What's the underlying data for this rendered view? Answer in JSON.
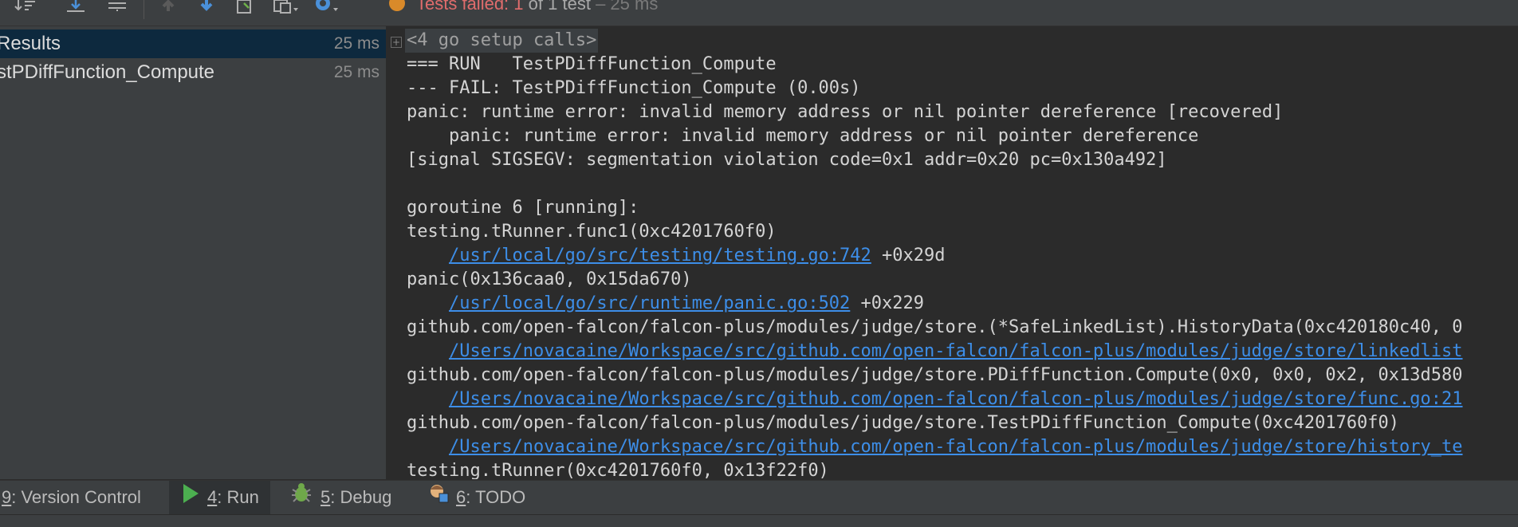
{
  "toolbar": {
    "status": {
      "failed": "Tests failed:",
      "count": "1",
      "of": "of 1 test",
      "time": "– 25 ms"
    }
  },
  "tree": {
    "items": [
      {
        "label": "Results",
        "duration": "25 ms"
      },
      {
        "label": "stPDiffFunction_Compute",
        "duration": "25 ms"
      }
    ]
  },
  "console": {
    "setup": "<4 go setup calls>",
    "lines": [
      {
        "text": "=== RUN   TestPDiffFunction_Compute"
      },
      {
        "text": "--- FAIL: TestPDiffFunction_Compute (0.00s)"
      },
      {
        "text": "panic: runtime error: invalid memory address or nil pointer dereference [recovered]"
      },
      {
        "text": "    panic: runtime error: invalid memory address or nil pointer dereference"
      },
      {
        "text": "[signal SIGSEGV: segmentation violation code=0x1 addr=0x20 pc=0x130a492]"
      },
      {
        "text": ""
      },
      {
        "text": "goroutine 6 [running]:"
      },
      {
        "text": "testing.tRunner.func1(0xc4201760f0)"
      },
      {
        "indent": "    ",
        "link": "/usr/local/go/src/testing/testing.go:742",
        "suffix": " +0x29d"
      },
      {
        "text": "panic(0x136caa0, 0x15da670)"
      },
      {
        "indent": "    ",
        "link": "/usr/local/go/src/runtime/panic.go:502",
        "suffix": " +0x229"
      },
      {
        "text": "github.com/open-falcon/falcon-plus/modules/judge/store.(*SafeLinkedList).HistoryData(0xc420180c40, 0"
      },
      {
        "indent": "    ",
        "link": "/Users/novacaine/Workspace/src/github.com/open-falcon/falcon-plus/modules/judge/store/linkedlist",
        "suffix": ""
      },
      {
        "text": "github.com/open-falcon/falcon-plus/modules/judge/store.PDiffFunction.Compute(0x0, 0x0, 0x2, 0x13d580"
      },
      {
        "indent": "    ",
        "link": "/Users/novacaine/Workspace/src/github.com/open-falcon/falcon-plus/modules/judge/store/func.go:21",
        "suffix": ""
      },
      {
        "text": "github.com/open-falcon/falcon-plus/modules/judge/store.TestPDiffFunction_Compute(0xc4201760f0)"
      },
      {
        "indent": "    ",
        "link": "/Users/novacaine/Workspace/src/github.com/open-falcon/falcon-plus/modules/judge/store/history_te",
        "suffix": ""
      },
      {
        "text": "testing.tRunner(0xc4201760f0, 0x13f22f0)"
      }
    ]
  },
  "bottombar": {
    "tabs": [
      {
        "key": "9",
        "label": ": Version Control",
        "icon": "none"
      },
      {
        "key": "4",
        "label": ": Run",
        "icon": "play-icon"
      },
      {
        "key": "5",
        "label": ": Debug",
        "icon": "bug-icon"
      },
      {
        "key": "6",
        "label": ": TODO",
        "icon": "todo-icon"
      }
    ]
  },
  "colors": {
    "link": "#3d8ee8",
    "failed": "#e06c6c",
    "run": "#4caf50",
    "warning": "#d98a2a",
    "selection": "#0d293e"
  }
}
